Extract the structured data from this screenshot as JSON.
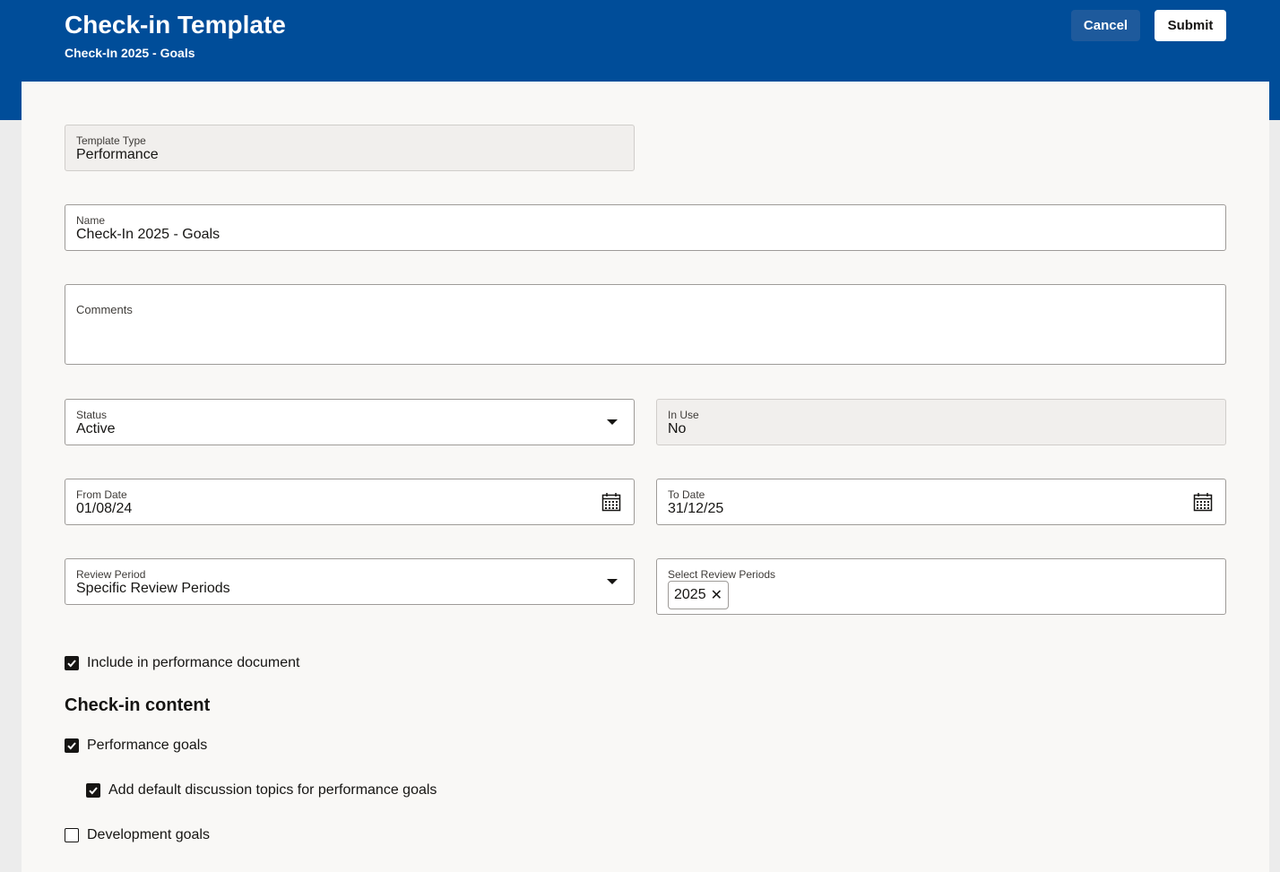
{
  "header": {
    "title": "Check-in Template",
    "subtitle": "Check-In 2025 - Goals",
    "cancel_label": "Cancel",
    "submit_label": "Submit"
  },
  "form": {
    "template_type": {
      "label": "Template Type",
      "value": "Performance"
    },
    "name": {
      "label": "Name",
      "value": "Check-In 2025 - Goals"
    },
    "comments": {
      "label": "Comments",
      "value": ""
    },
    "status": {
      "label": "Status",
      "value": "Active"
    },
    "in_use": {
      "label": "In Use",
      "value": "No"
    },
    "from_date": {
      "label": "From Date",
      "value": "01/08/24"
    },
    "to_date": {
      "label": "To Date",
      "value": "31/12/25"
    },
    "review_period": {
      "label": "Review Period",
      "value": "Specific Review Periods"
    },
    "select_review_periods": {
      "label": "Select Review Periods",
      "chips": [
        "2025"
      ]
    },
    "include_in_doc": {
      "label": "Include in performance document",
      "checked": true
    }
  },
  "checkin_content": {
    "title": "Check-in content",
    "performance_goals": {
      "label": "Performance goals",
      "checked": true
    },
    "default_topics": {
      "label": "Add default discussion topics for performance goals",
      "checked": true
    },
    "development_goals": {
      "label": "Development goals",
      "checked": false
    }
  },
  "colors": {
    "header_bg": "#004d99",
    "cancel_bg": "#1e5a9c",
    "card_bg": "#f9f8f6"
  },
  "icons": {
    "dropdown": "chevron-down-icon",
    "calendar": "calendar-icon",
    "chip_remove": "close-icon",
    "check": "checkmark-icon"
  }
}
